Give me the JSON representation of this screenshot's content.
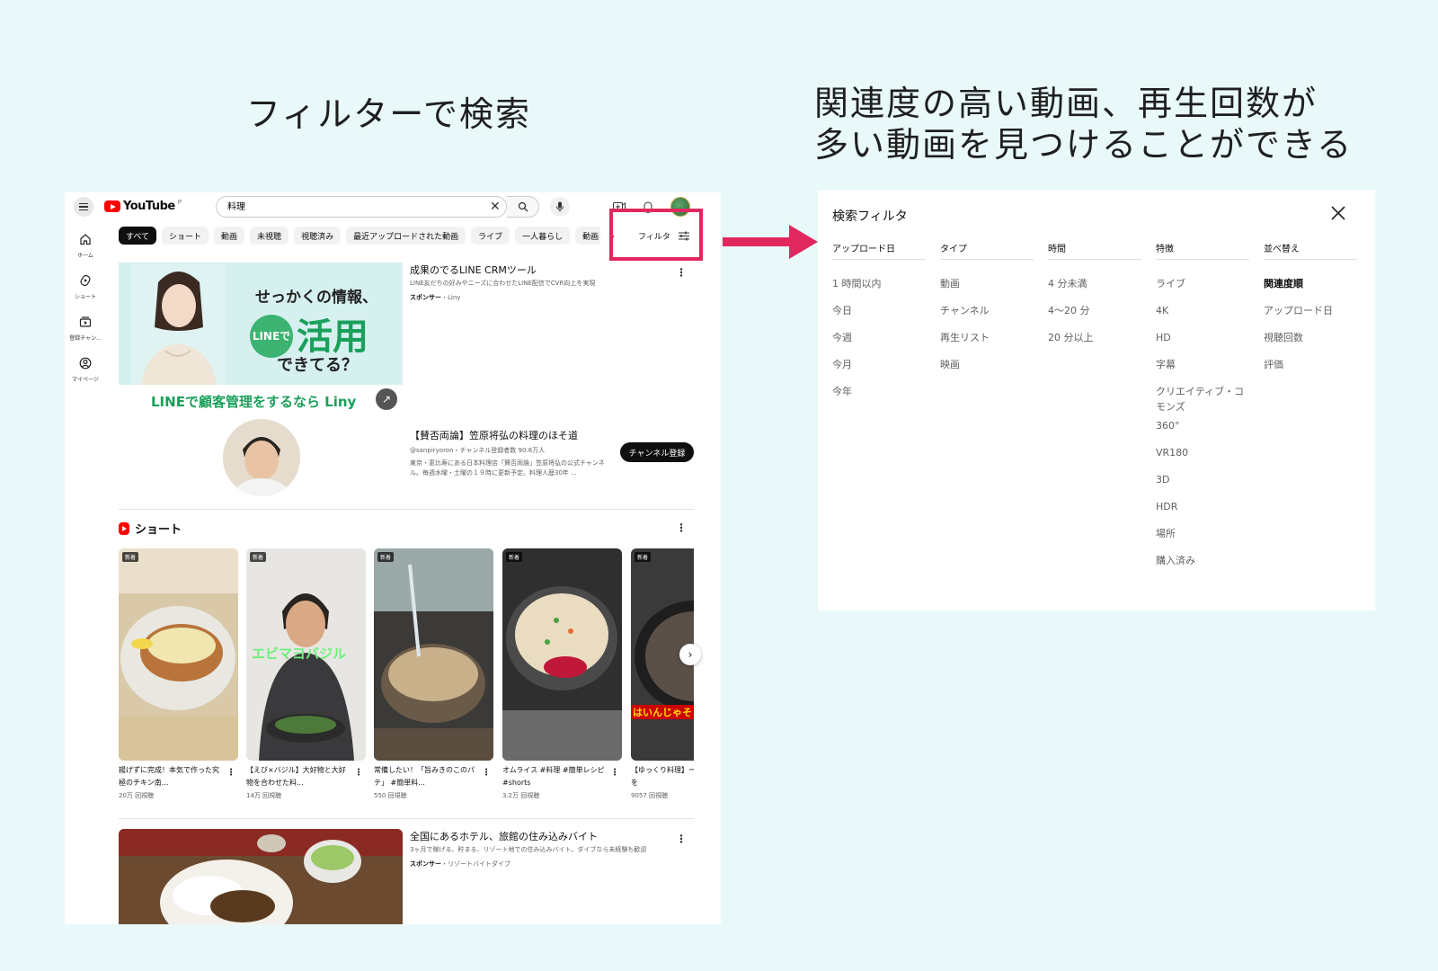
{
  "headings": {
    "left": "フィルターで検索",
    "right_line1": "関連度の高い動画、再生回数が",
    "right_line2": "多い動画を見つけることができる"
  },
  "youtube": {
    "logo_text": "YouTube",
    "logo_region": "JP",
    "search_value": "料理",
    "chips": [
      "すべて",
      "ショート",
      "動画",
      "未視聴",
      "視聴済み",
      "最近アップロードされた動画",
      "ライブ",
      "一人暮らし",
      "動画 人気"
    ],
    "filter_label": "フィルタ",
    "sidebar": [
      {
        "icon": "home-icon",
        "label": "ホーム"
      },
      {
        "icon": "shorts-icon",
        "label": "ショート"
      },
      {
        "icon": "subscriptions-icon",
        "label": "登録チャン..."
      },
      {
        "icon": "account-icon",
        "label": "マイページ"
      }
    ],
    "ad": {
      "banner_line1": "せっかくの情報、",
      "banner_line_badge": "LINEで",
      "banner_line2": "活用",
      "banner_line3": "できてる？",
      "banner_bottom": "LINEで顧客管理をするなら Liny",
      "title": "成果のでるLINE CRMツール",
      "description": "LINE友だちの好みやニーズに合わせたLINE配信でCVR向上を実現",
      "sponsor_label": "スポンサー",
      "sponsor_name": "・Liny"
    },
    "channel": {
      "title": "【賛否両論】笠原将弘の料理のほそ道",
      "meta": "@sanpiryoron・チャンネル登録者数 90.8万人",
      "description": "東京・恵比寿にある日本料理店「賛否両論」笠原将弘の公式チャンネル。毎週水曜・土曜の１９時に更新予定。料理人歴30年 ...",
      "subscribe_label": "チャンネル登録"
    },
    "shorts": {
      "heading": "ショート",
      "new_badge": "新着",
      "items": [
        {
          "title": "揚げずに完成！本気で作った究極のチキン南...",
          "views": "20万 回視聴"
        },
        {
          "title": "【えび×バジル】大好物と大好物を合わせた料...",
          "views": "14万 回視聴"
        },
        {
          "title": "常備したい！「旨みきのこのパテ」 #簡単料...",
          "views": "550 回視聴"
        },
        {
          "title": "オムライス #料理 #簡単レシピ #shorts",
          "views": "3.2万 回視聴"
        },
        {
          "title": "【ゆっくり料理】ーマンポテトを",
          "views": "9057 回視聴"
        }
      ],
      "overlay_text_2": "エビマヨバジル",
      "overlay_text_5": "はいんじゃそ"
    },
    "bottom_ad": {
      "title": "全国にあるホテル、旅館の住み込みバイト",
      "description": "3ヶ月で稼げる、貯まる、リゾート地での住み込みバイト。ダイブなら未経験も歓迎",
      "sponsor_label": "スポンサー",
      "sponsor_name": "・リゾートバイトダイブ"
    }
  },
  "filter_panel": {
    "title": "検索フィルタ",
    "columns": [
      {
        "heading": "アップロード日",
        "options": [
          "1 時間以内",
          "今日",
          "今週",
          "今月",
          "今年"
        ]
      },
      {
        "heading": "タイプ",
        "options": [
          "動画",
          "チャンネル",
          "再生リスト",
          "映画"
        ]
      },
      {
        "heading": "時間",
        "options": [
          "4 分未満",
          "4〜20 分",
          "20 分以上"
        ]
      },
      {
        "heading": "特徴",
        "options": [
          "ライブ",
          "4K",
          "HD",
          "字幕",
          "クリエイティブ・コモンズ",
          "360°",
          "VR180",
          "3D",
          "HDR",
          "場所",
          "購入済み"
        ]
      },
      {
        "heading": "並べ替え",
        "options": [
          "関連度順",
          "アップロード日",
          "視聴回数",
          "評価"
        ],
        "selected": "関連度順"
      }
    ]
  },
  "colors": {
    "background": "#e9f9f9",
    "highlight": "#e0285f",
    "youtube_red": "#ff0000",
    "line_green": "#1aa05a"
  }
}
